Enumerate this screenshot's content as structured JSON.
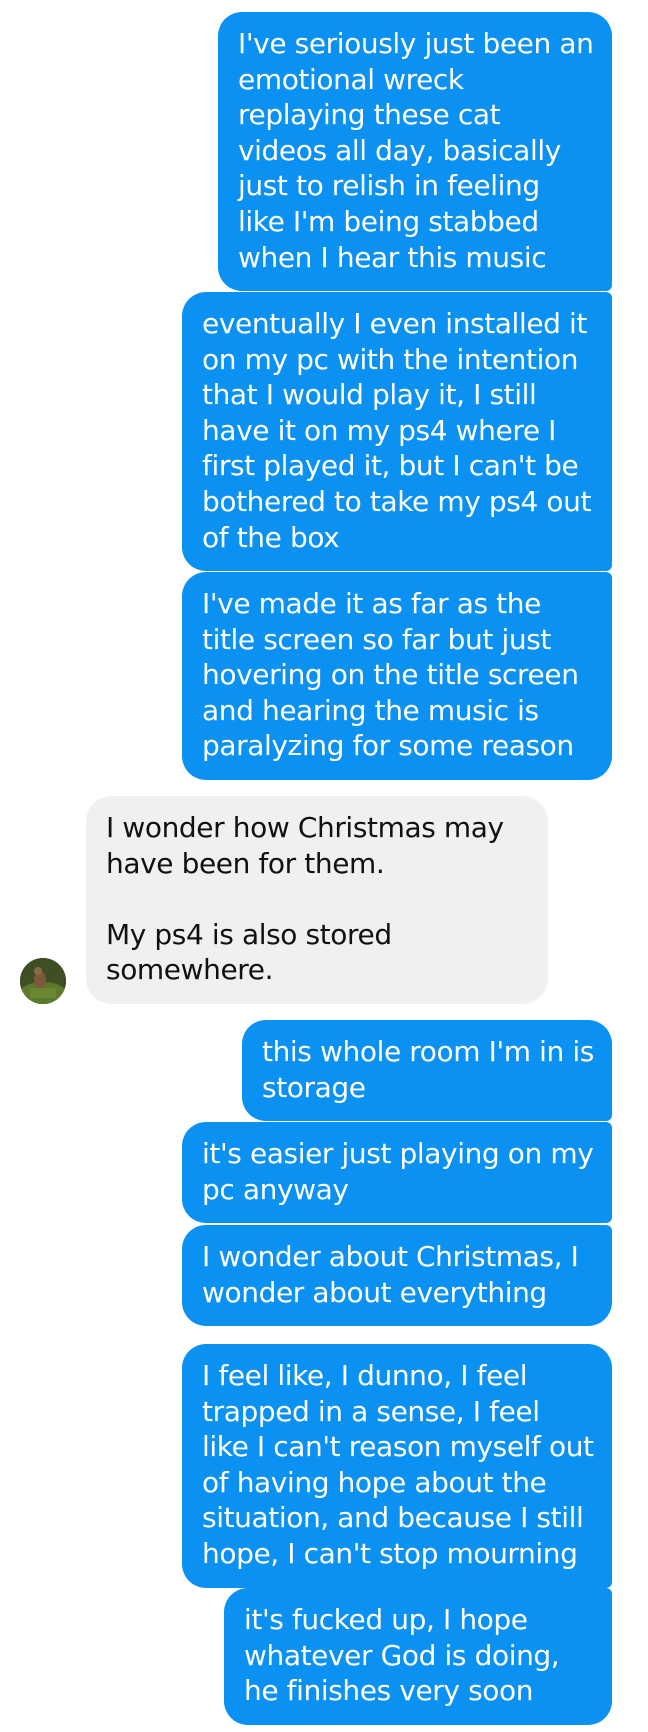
{
  "conversation": {
    "messages": [
      {
        "from": "me",
        "text": "I've seriously just been an emotional wreck replaying these cat videos all day, basically just to relish in feeling like I'm being stabbed when I hear this music"
      },
      {
        "from": "me",
        "text": "eventually I even installed it on my pc with the intention that I would play it, I still have it on my ps4 where I first played it, but I can't be bothered to take my ps4 out of the box"
      },
      {
        "from": "me",
        "text": "I've made it as far as the title screen so far but just hovering on the title screen and hearing the music is paralyzing for some reason"
      },
      {
        "from": "them",
        "text": "I wonder how Christmas may have been for them.\n\nMy ps4 is also stored somewhere."
      },
      {
        "from": "me",
        "text": "this whole room I'm in is storage"
      },
      {
        "from": "me",
        "text": "it's easier just playing on my pc anyway"
      },
      {
        "from": "me",
        "text": "I wonder about Christmas, I wonder about everything"
      },
      {
        "from": "me",
        "text": "I feel like, I dunno, I feel trapped in a sense, I feel like I can't reason myself out of having hope about the situation, and because I still hope, I can't stop mourning"
      },
      {
        "from": "me",
        "text": "it's fucked up, I hope whatever God is doing, he finishes very soon"
      }
    ]
  },
  "colors": {
    "outgoing_bubble": "#0a91f2",
    "incoming_bubble": "#f0f0f0",
    "outgoing_text": "#ffffff",
    "incoming_text": "#111111"
  },
  "icons": {
    "contact_avatar": "avatar-icon"
  }
}
